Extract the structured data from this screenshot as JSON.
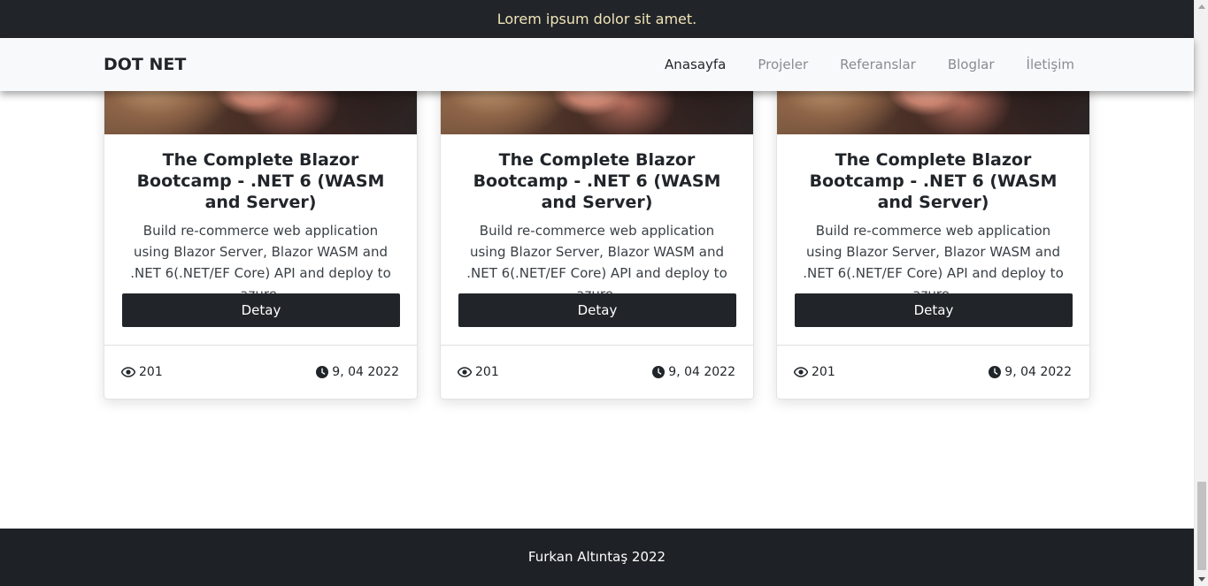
{
  "topbar": {
    "text": "Lorem ipsum dolor sit amet."
  },
  "navbar": {
    "brand": "DOT NET",
    "links": [
      "Anasayfa",
      "Projeler",
      "Referanslar",
      "Bloglar",
      "İletişim"
    ],
    "active_index": 0
  },
  "cards": [
    {
      "title": "The Complete Blazor Bootcamp - .NET 6 (WASM and Server)",
      "description": "Build re-commerce web application using Blazor Server, Blazor WASM and .NET 6(.NET/EF Core) API and deploy to azure.",
      "button_label": "Detay",
      "views": "201",
      "date": "9, 04 2022"
    },
    {
      "title": "The Complete Blazor Bootcamp - .NET 6 (WASM and Server)",
      "description": "Build re-commerce web application using Blazor Server, Blazor WASM and .NET 6(.NET/EF Core) API and deploy to azure.",
      "button_label": "Detay",
      "views": "201",
      "date": "9, 04 2022"
    },
    {
      "title": "The Complete Blazor Bootcamp - .NET 6 (WASM and Server)",
      "description": "Build re-commerce web application using Blazor Server, Blazor WASM and .NET 6(.NET/EF Core) API and deploy to azure.",
      "button_label": "Detay",
      "views": "201",
      "date": "9, 04 2022"
    }
  ],
  "icons": {
    "views": "eye-icon",
    "date": "clock-icon"
  },
  "footer": {
    "text": "Furkan Altıntaş 2022"
  },
  "colors": {
    "dark": "#212529",
    "topbar_text": "#f1e3b8",
    "nav_inactive": "#888c91"
  }
}
